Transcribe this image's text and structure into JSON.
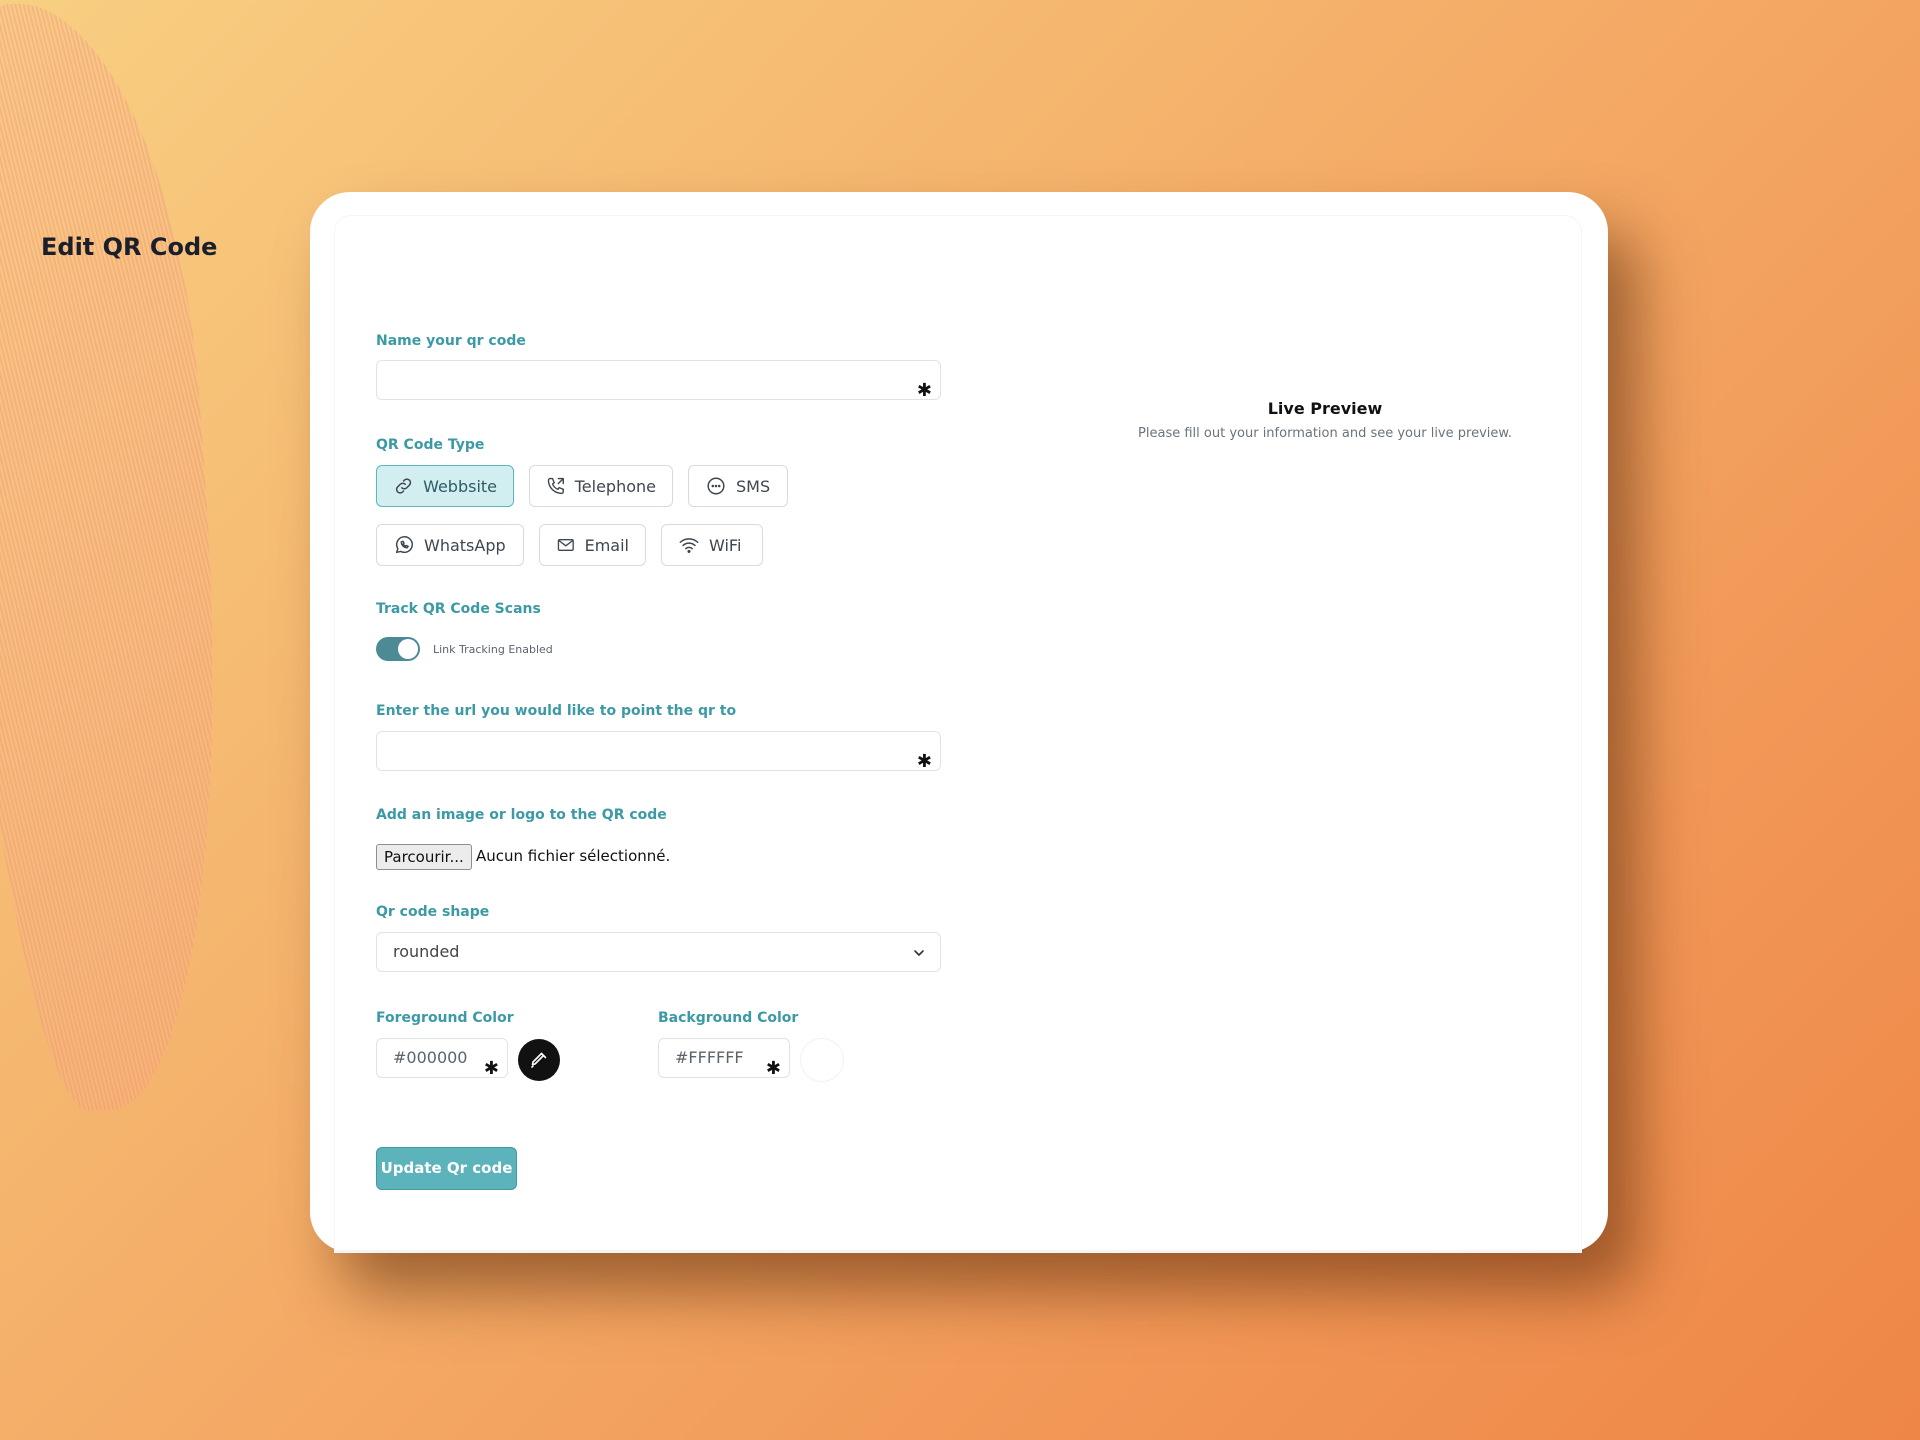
{
  "page": {
    "title": "Edit QR Code"
  },
  "form": {
    "name_label": "Name your qr code",
    "name_value": "",
    "required_mark": "✱",
    "type_label": "QR Code Type",
    "types": [
      {
        "label": "Webbsite",
        "icon": "link-icon",
        "active": true
      },
      {
        "label": "Telephone",
        "icon": "phone-icon",
        "active": false
      },
      {
        "label": "SMS",
        "icon": "chat-icon",
        "active": false
      },
      {
        "label": "WhatsApp",
        "icon": "whatsapp-icon",
        "active": false
      },
      {
        "label": "Email",
        "icon": "mail-icon",
        "active": false
      },
      {
        "label": "WiFi",
        "icon": "wifi-icon",
        "active": false
      }
    ],
    "tracking_label": "Track QR Code Scans",
    "tracking_toggle_text": "Link Tracking Enabled",
    "tracking_enabled": true,
    "url_label": "Enter the url you would like to point the qr to",
    "url_value": "",
    "image_label": "Add an image or logo to the QR code",
    "file_button": "Parcourir...",
    "file_status": "Aucun fichier sélectionné.",
    "shape_label": "Qr code shape",
    "shape_value": "rounded",
    "fg_label": "Foreground Color",
    "fg_value": "#000000",
    "bg_label": "Background Color",
    "bg_value": "#FFFFFF",
    "submit_label": "Update Qr code"
  },
  "preview": {
    "title": "Live Preview",
    "subtitle": "Please fill out your information and see your live preview."
  },
  "colors": {
    "accent": "#3c9aa5",
    "button": "#5db3bc",
    "toggle": "#4d8a96"
  }
}
